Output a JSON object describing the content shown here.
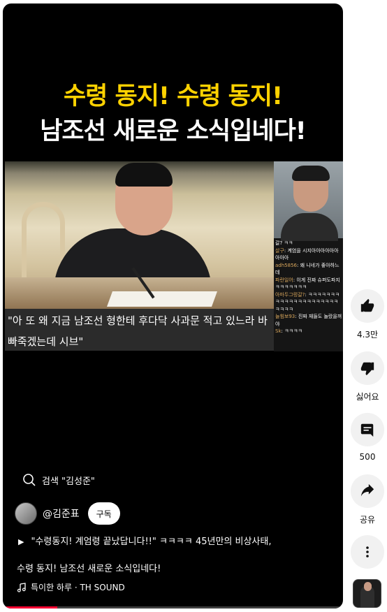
{
  "video": {
    "headline_line1": "수령 동지! 수령 동지!",
    "headline_line2": "남조선 새로운 소식입네다!",
    "caption": "\"아 또 왜 지금 남조선 형한테 후다닥 사과문 적고 있느라 바빠죽겠는데 시브\"",
    "chat": [
      {
        "user": "",
        "text": "갈? ㅋㅋ"
      },
      {
        "user": "살구",
        "text": ": 계엄을 시지아아아아아아아아아"
      },
      {
        "user": "adh5856",
        "text": ": 왜 니네가 좋아하느데"
      },
      {
        "user": "파란일어",
        "text": ": 이게 진짜 슈퍼도파지ㅋㅋㅋㅋㅋㅋㅋ"
      },
      {
        "user": "아마두그렁갈?",
        "text": ": ㅋㅋㅋㅋㅋㅋㅋㅋㅋㅋㅋㅋㅋㅋㅋㅋㅋㅋㅋㅋㅋㅋㅋㅋㅋ"
      },
      {
        "user": "늘힘보93",
        "text": ": 진짜 재들도 놀랐을꺼야"
      },
      {
        "user": "Sk",
        "text": ": ㅋㅋㅋㅋ"
      }
    ],
    "progress_fraction": 0.16
  },
  "search": {
    "label": "검색 \"김성준\""
  },
  "channel": {
    "handle": "@김준표",
    "subscribe_label": "구독"
  },
  "title": {
    "line1": "\"수령동지! 계엄령 끝났답니다!!\" ㅋㅋㅋㅋ 45년만의 비상사태,",
    "line2": "수령 동지! 남조선 새로운 소식입네다!"
  },
  "music": {
    "label": "특이한 하루 · TH SOUND"
  },
  "actions": {
    "like_count": "4.3만",
    "dislike_label": "싫어요",
    "comment_count": "500",
    "share_label": "공유"
  },
  "icons": {
    "like": "thumb-up-icon",
    "dislike": "thumb-down-icon",
    "comment": "comment-icon",
    "share": "share-icon",
    "more": "more-vert-icon",
    "search": "search-icon",
    "music": "music-note-icon"
  },
  "colors": {
    "headline_yellow": "#ffd200",
    "progress_red": "#ff0033",
    "background": "#000000"
  }
}
